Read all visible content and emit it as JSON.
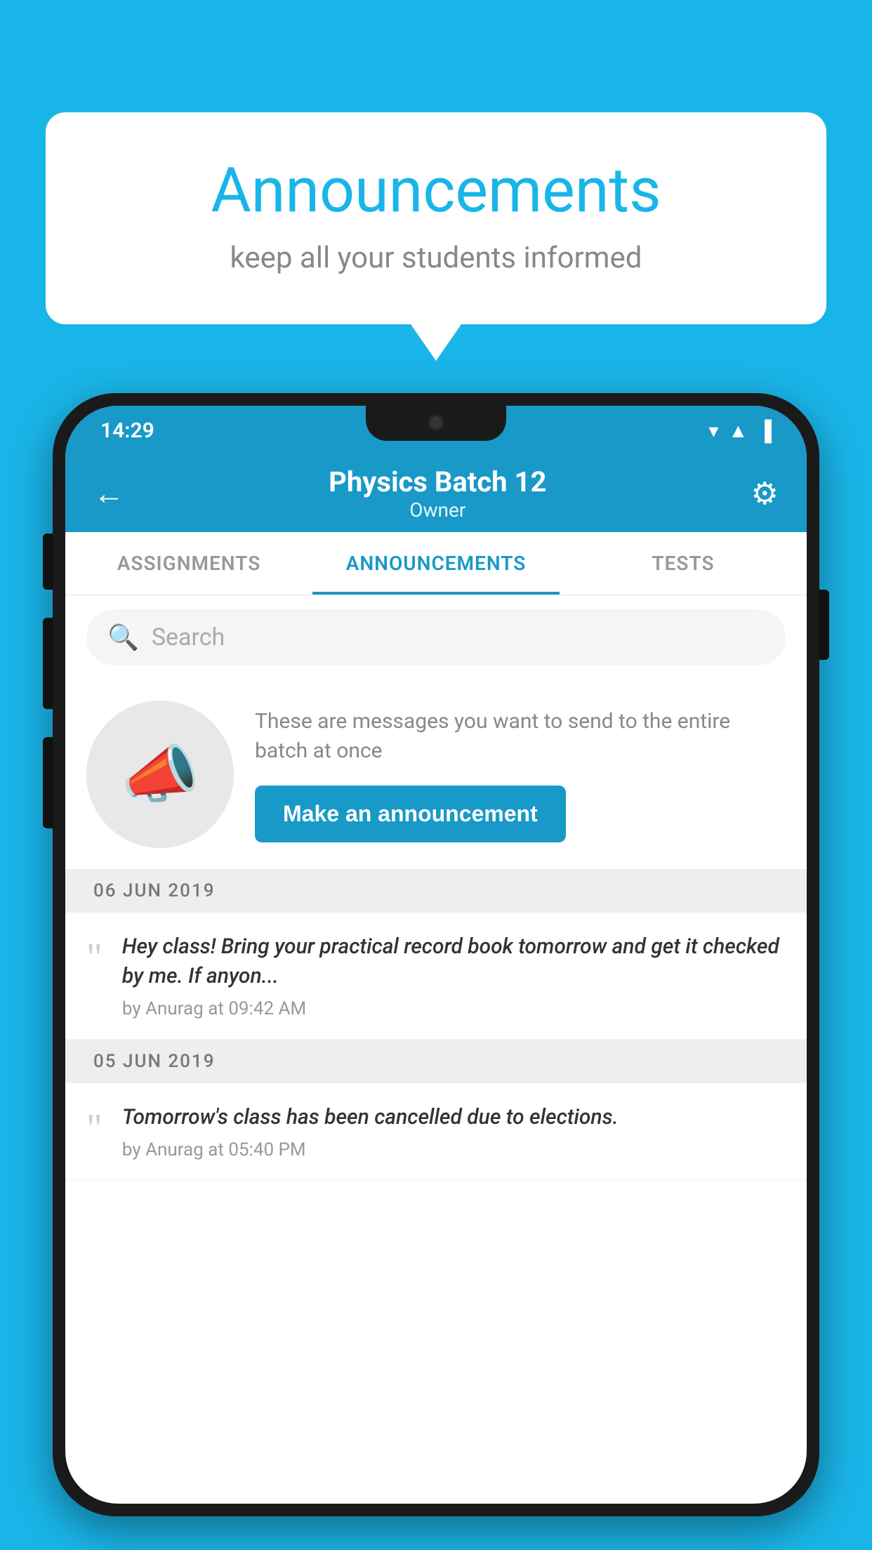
{
  "background_color": "#1ab5e8",
  "speech_bubble": {
    "title": "Announcements",
    "subtitle": "keep all your students informed"
  },
  "phone": {
    "status_bar": {
      "time": "14:29",
      "icons": [
        "wifi",
        "signal",
        "battery"
      ]
    },
    "app_bar": {
      "back_label": "←",
      "title": "Physics Batch 12",
      "subtitle": "Owner",
      "gear_label": "⚙"
    },
    "tabs": [
      {
        "label": "ASSIGNMENTS",
        "active": false
      },
      {
        "label": "ANNOUNCEMENTS",
        "active": true
      },
      {
        "label": "TESTS",
        "active": false
      }
    ],
    "search": {
      "placeholder": "Search"
    },
    "promo": {
      "description": "These are messages you want to send to the entire batch at once",
      "button_label": "Make an announcement"
    },
    "announcements": [
      {
        "date": "06  JUN  2019",
        "message": "Hey class! Bring your practical record book tomorrow and get it checked by me. If anyon...",
        "meta": "by Anurag at 09:42 AM"
      },
      {
        "date": "05  JUN  2019",
        "message": "Tomorrow's class has been cancelled due to elections.",
        "meta": "by Anurag at 05:40 PM"
      }
    ]
  }
}
